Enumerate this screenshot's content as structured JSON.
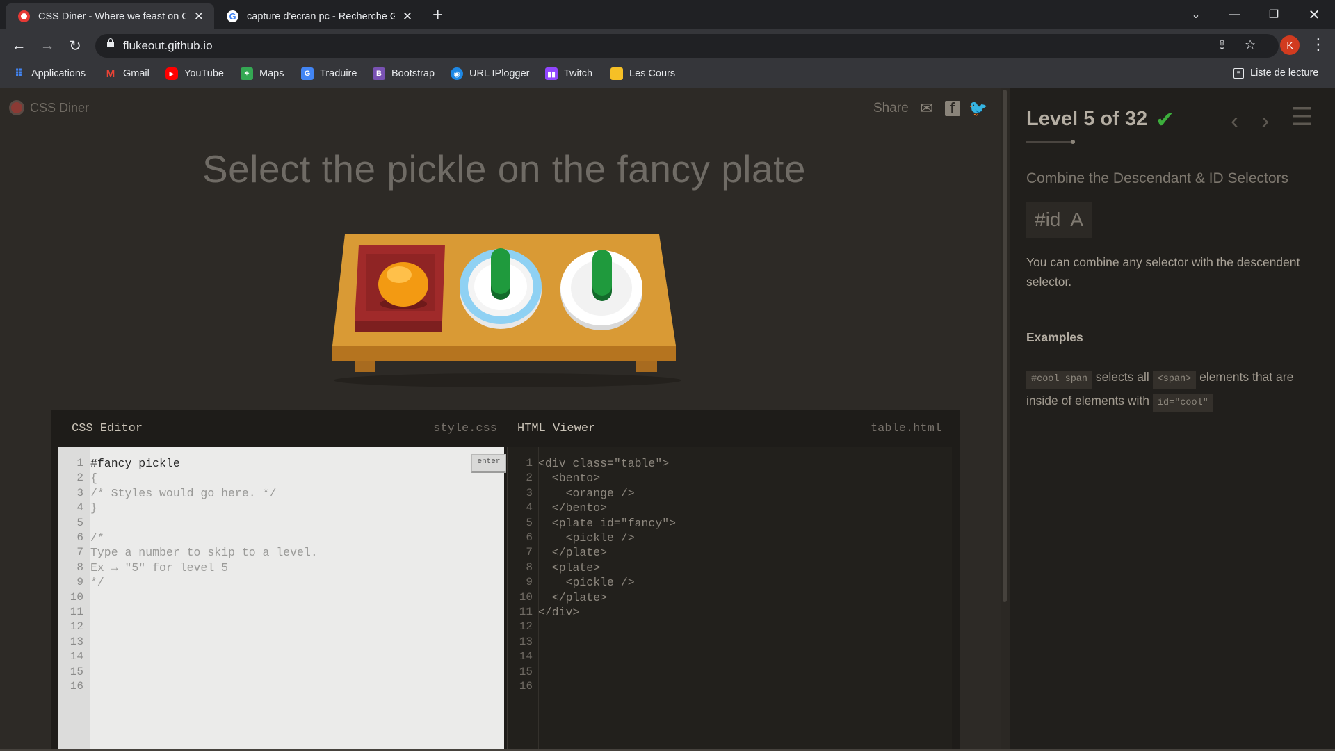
{
  "browser": {
    "tabs": [
      {
        "title": "CSS Diner - Where we feast on CSS",
        "active": true,
        "favicon_color": "#e53935"
      },
      {
        "title": "capture d'ecran pc - Recherche Google",
        "active": false,
        "favicon_color": "#ffffff"
      }
    ],
    "url": "flukeout.github.io",
    "profile_initial": "K",
    "bookmarks": [
      {
        "label": "Applications",
        "icon": "apps-grid-icon",
        "color": "#4285f4"
      },
      {
        "label": "Gmail",
        "icon": "gmail-icon",
        "color": "#ea4335"
      },
      {
        "label": "YouTube",
        "icon": "youtube-icon",
        "color": "#ff0000"
      },
      {
        "label": "Maps",
        "icon": "maps-icon",
        "color": "#34a853"
      },
      {
        "label": "Traduire",
        "icon": "translate-icon",
        "color": "#4285f4"
      },
      {
        "label": "Bootstrap",
        "icon": "bootstrap-icon",
        "color": "#7952b3"
      },
      {
        "label": "URL IPlogger",
        "icon": "iplogger-icon",
        "color": "#1e88e5"
      },
      {
        "label": "Twitch",
        "icon": "twitch-icon",
        "color": "#9146ff"
      },
      {
        "label": "Les Cours",
        "icon": "folder-icon",
        "color": "#f6c026"
      }
    ],
    "reading_list": "Liste de lecture"
  },
  "page": {
    "logo_text": "CSS Diner",
    "share_label": "Share",
    "headline": "Select the pickle on the fancy plate"
  },
  "css_editor": {
    "title": "CSS Editor",
    "file": "style.css",
    "enter_label": "enter",
    "line_numbers": [
      "1",
      "2",
      "3",
      "4",
      "5",
      "6",
      "7",
      "8",
      "9",
      "10",
      "11",
      "12",
      "13",
      "14",
      "15",
      "16"
    ],
    "lines": [
      "#fancy pickle",
      "{",
      "/* Styles would go here. */",
      "}",
      "",
      "/*",
      "Type a number to skip to a level.",
      "Ex → \"5\" for level 5",
      "*/"
    ]
  },
  "html_viewer": {
    "title": "HTML Viewer",
    "file": "table.html",
    "line_numbers": [
      "1",
      "2",
      "3",
      "4",
      "5",
      "6",
      "7",
      "8",
      "9",
      "10",
      "11",
      "12",
      "13",
      "14",
      "15",
      "16"
    ],
    "lines": [
      "<div class=\"table\">",
      "  <bento>",
      "    <orange />",
      "  </bento>",
      "  <plate id=\"fancy\">",
      "    <pickle />",
      "  </plate>",
      "  <plate>",
      "    <pickle />",
      "  </plate>",
      "</div>"
    ]
  },
  "sidebar": {
    "level_text": "Level 5 of 32",
    "check": "✔",
    "subtitle": "Combine the Descendant & ID Selectors",
    "syntax": "#id  A",
    "description": "You can combine any selector with the descendent selector.",
    "examples_title": "Examples",
    "example": {
      "code1": "#cool span",
      "text1": "selects all",
      "code2": "<span>",
      "text2": "elements that are inside of elements with",
      "code3": "id=\"cool\""
    }
  },
  "colors": {
    "accent_check": "#3cae3c",
    "table": "#d89a32",
    "bento": "#a52a2a",
    "orange": "#f5a623",
    "pickle": "#1f8f3a",
    "fancy_plate_rim": "#8fd1f3"
  }
}
